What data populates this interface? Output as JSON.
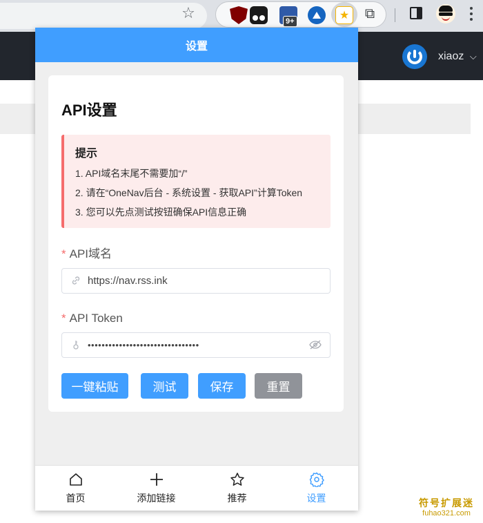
{
  "browser": {
    "extension_badge": "9+",
    "icons": [
      "star-outline-icon",
      "ublock-icon",
      "tampermonkey-icon",
      "blue-extension-icon",
      "triangle-extension-icon",
      "onenav-extension-icon",
      "puzzle-icon",
      "side-panel-icon",
      "profile-avatar",
      "kebab-menu-icon"
    ]
  },
  "site": {
    "username": "xiaoz",
    "dropdown_glyph": "⌵"
  },
  "popup": {
    "header_title": "设置",
    "card": {
      "title": "API设置",
      "alert": {
        "title": "提示",
        "lines": [
          "1. API域名末尾不需要加“/”",
          "2. 请在“OneNav后台 - 系统设置 - 获取API”计算Token",
          "3. 您可以先点测试按钮确保API信息正确"
        ]
      },
      "domain_field": {
        "required_mark": "*",
        "label": "API域名",
        "value": "https://nav.rss.ink"
      },
      "token_field": {
        "required_mark": "*",
        "label": "API Token",
        "masked_value": "••••••••••••••••••••••••••••••••"
      },
      "buttons": {
        "paste": "一键粘贴",
        "test": "测试",
        "save": "保存",
        "reset": "重置"
      }
    },
    "bottom_nav": [
      {
        "label": "首页",
        "icon": "home-icon",
        "active": false
      },
      {
        "label": "添加链接",
        "icon": "plus-icon",
        "active": false
      },
      {
        "label": "推荐",
        "icon": "star-icon",
        "active": false
      },
      {
        "label": "设置",
        "icon": "gear-icon",
        "active": true
      }
    ]
  },
  "watermark": {
    "cn": "符号扩展迷",
    "en": "fuhao321.com"
  },
  "colors": {
    "primary": "#409eff",
    "danger": "#f56c6c",
    "info": "#909399",
    "alert_bg": "#fdecec",
    "site_header": "#22262d"
  }
}
